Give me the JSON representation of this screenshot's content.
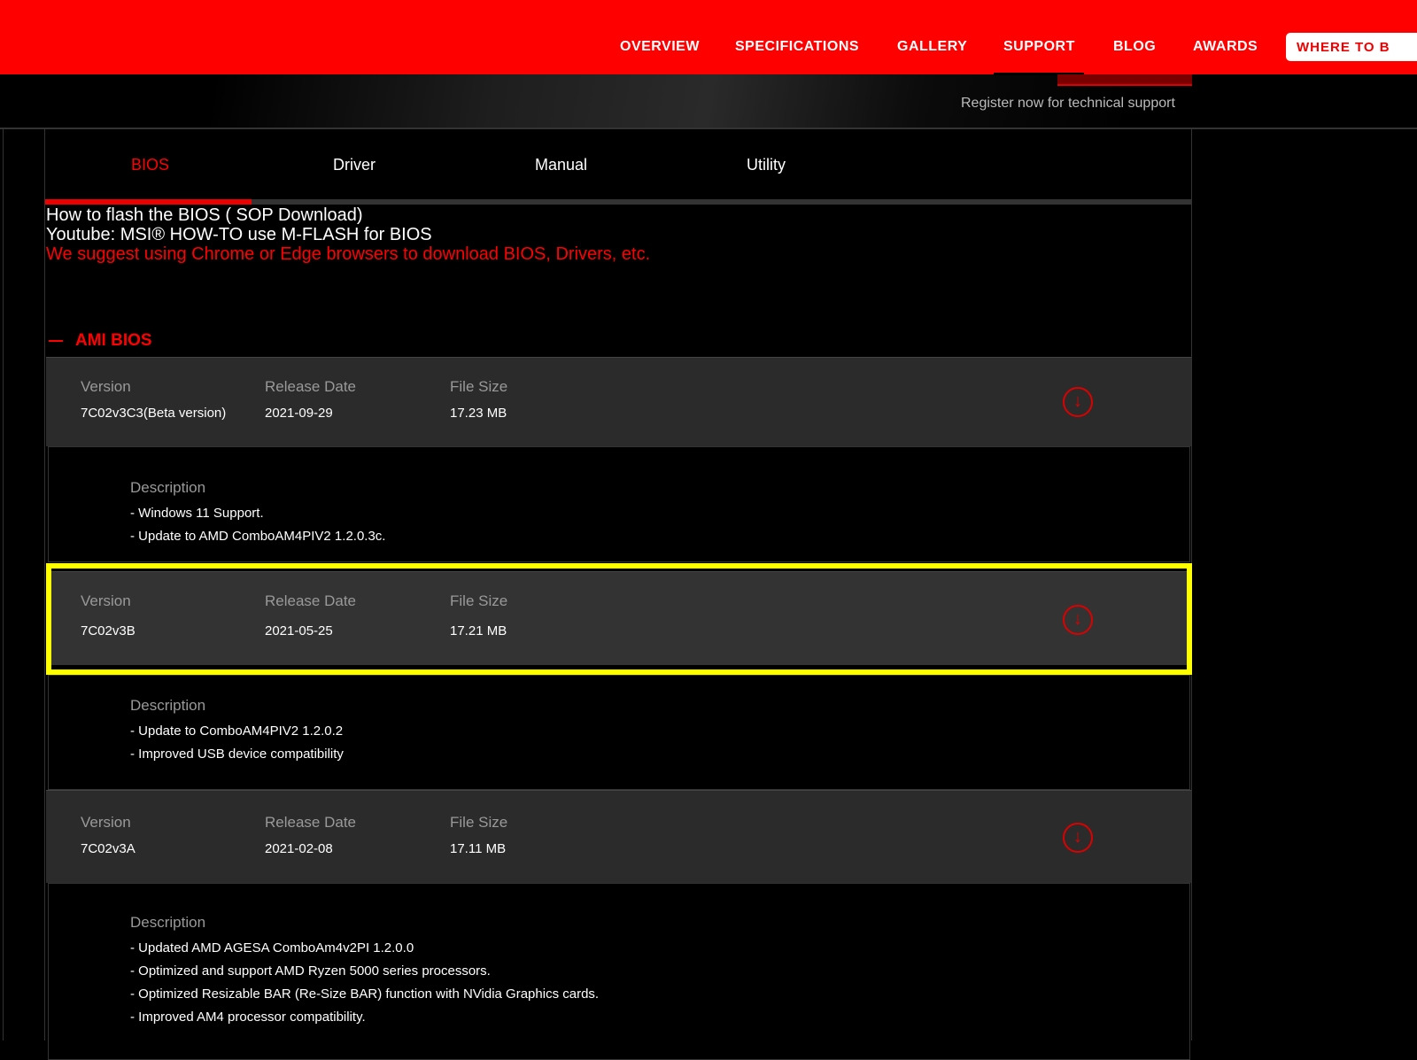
{
  "nav": {
    "items": [
      "OVERVIEW",
      "SPECIFICATIONS",
      "GALLERY",
      "SUPPORT",
      "BLOG",
      "AWARDS"
    ],
    "where_to_buy": "WHERE TO B",
    "register": "Register now for technical support"
  },
  "tabs": [
    "BIOS",
    "Driver",
    "Manual",
    "Utility"
  ],
  "info": {
    "flash": "How to flash the BIOS ( SOP Download)",
    "youtube": "Youtube: MSI® HOW-TO use M-FLASH for BIOS",
    "warning": "We suggest using Chrome or Edge browsers to download BIOS, Drivers, etc."
  },
  "section": "AMI BIOS",
  "labels": {
    "version": "Version",
    "date": "Release Date",
    "size": "File Size",
    "description": "Description"
  },
  "bios": [
    {
      "version": "7C02v3C3(Beta version)",
      "date": "2021-09-29",
      "size": "17.23 MB",
      "desc": [
        "- Windows 11 Support.",
        "- Update to AMD ComboAM4PIV2 1.2.0.3c."
      ]
    },
    {
      "version": "7C02v3B",
      "date": "2021-05-25",
      "size": "17.21 MB",
      "desc": [
        "- Update to ComboAM4PIV2 1.2.0.2",
        "- Improved USB device compatibility"
      ]
    },
    {
      "version": "7C02v3A",
      "date": "2021-02-08",
      "size": "17.11 MB",
      "desc": [
        "- Updated AMD AGESA ComboAm4v2PI 1.2.0.0",
        "- Optimized and support AMD Ryzen 5000 series processors.",
        "- Optimized Resizable BAR (Re-Size BAR) function with NVidia Graphics cards.",
        "- Improved AM4 processor compatibility."
      ]
    }
  ],
  "colors": {
    "brand": "#fe0000",
    "highlight": "#ffff00"
  }
}
